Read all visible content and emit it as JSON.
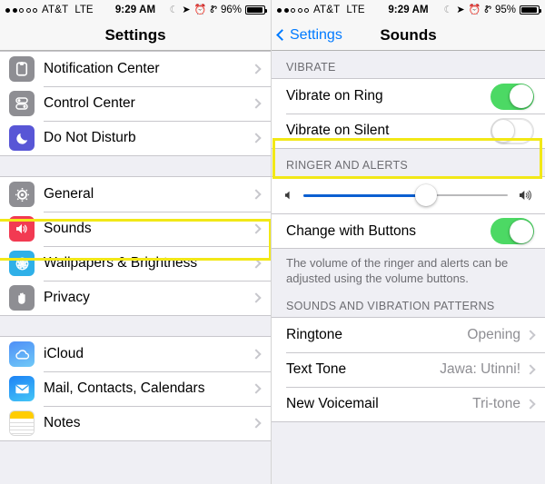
{
  "left": {
    "status": {
      "signal_dots_filled": 2,
      "signal_dots_total": 5,
      "carrier": "AT&T",
      "network": "LTE",
      "time": "9:29 AM",
      "battery_percent": "96%",
      "icons": [
        "moon-icon",
        "location-arrow-icon",
        "alarm-clock-icon",
        "bluetooth-icon",
        "battery-icon"
      ]
    },
    "navbar": {
      "title": "Settings"
    },
    "groups": [
      {
        "rows": [
          {
            "label": "Notification Center",
            "icon": "notification-center-icon",
            "accessory": "chevron"
          },
          {
            "label": "Control Center",
            "icon": "control-center-icon",
            "accessory": "chevron"
          },
          {
            "label": "Do Not Disturb",
            "icon": "do-not-disturb-icon",
            "accessory": "chevron"
          }
        ]
      },
      {
        "rows": [
          {
            "label": "General",
            "icon": "general-gear-icon",
            "accessory": "chevron"
          },
          {
            "label": "Sounds",
            "icon": "sounds-speaker-icon",
            "accessory": "chevron",
            "highlighted": true
          },
          {
            "label": "Wallpapers & Brightness",
            "icon": "wallpapers-icon",
            "accessory": "chevron"
          },
          {
            "label": "Privacy",
            "icon": "privacy-hand-icon",
            "accessory": "chevron"
          }
        ]
      },
      {
        "rows": [
          {
            "label": "iCloud",
            "icon": "icloud-icon",
            "accessory": "chevron"
          },
          {
            "label": "Mail, Contacts, Calendars",
            "icon": "mail-icon",
            "accessory": "chevron"
          },
          {
            "label": "Notes",
            "icon": "notes-icon",
            "accessory": "chevron"
          }
        ]
      }
    ]
  },
  "right": {
    "status": {
      "signal_dots_filled": 2,
      "signal_dots_total": 5,
      "carrier": "AT&T",
      "network": "LTE",
      "time": "9:29 AM",
      "battery_percent": "95%",
      "icons": [
        "moon-icon",
        "location-arrow-icon",
        "alarm-clock-icon",
        "bluetooth-icon",
        "battery-icon"
      ]
    },
    "navbar": {
      "back_label": "Settings",
      "title": "Sounds"
    },
    "vibrate": {
      "header": "VIBRATE",
      "rows": [
        {
          "label": "Vibrate on Ring",
          "toggle": "on"
        },
        {
          "label": "Vibrate on Silent",
          "toggle": "off",
          "highlighted": true
        }
      ]
    },
    "ringer": {
      "header": "RINGER AND ALERTS",
      "slider": {
        "value_percent": 60,
        "left_icon": "volume-low-icon",
        "right_icon": "volume-high-icon"
      },
      "change_with_buttons": {
        "label": "Change with Buttons",
        "toggle": "on"
      },
      "footnote": "The volume of the ringer and alerts can be adjusted using the volume buttons."
    },
    "patterns": {
      "header": "SOUNDS AND VIBRATION PATTERNS",
      "rows": [
        {
          "label": "Ringtone",
          "value": "Opening"
        },
        {
          "label": "Text Tone",
          "value": "Jawa: Utinni!"
        },
        {
          "label": "New Voicemail",
          "value": "Tri-tone"
        }
      ]
    }
  },
  "colors": {
    "accent_blue": "#007aff",
    "toggle_green": "#4cd964",
    "highlight_yellow": "#f2e817",
    "slider_fill": "#0b5fd1",
    "group_bg": "#efeff4"
  }
}
